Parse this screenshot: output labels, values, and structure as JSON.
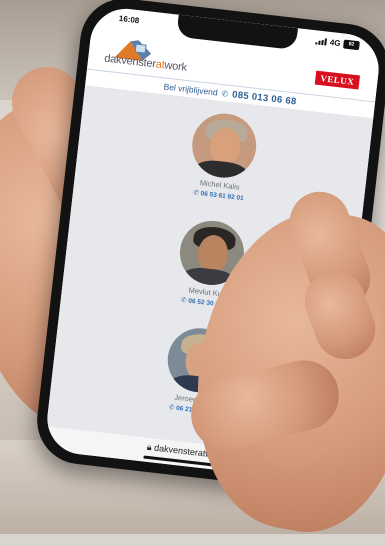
{
  "status": {
    "time": "16:08",
    "signal": "4G",
    "battery": "82"
  },
  "header": {
    "logo_main": "dakvenster",
    "logo_accent": "at",
    "logo_end": "work",
    "velux": "VELUX"
  },
  "callbar": {
    "label": "Bel vrijblijvend",
    "number": "085 013 06 68"
  },
  "people": [
    {
      "name": "Michel Kalis",
      "phone": "06 53 61 92 01"
    },
    {
      "name": "Mevlut Kurt",
      "phone": "06 52 30 86 12"
    },
    {
      "name": "Jeroen Duits",
      "phone": "06 21 25 37 06"
    }
  ],
  "address": {
    "url": "dakvensteratwork.n"
  },
  "colors": {
    "accent": "#2f6fb3",
    "brand_orange": "#e07a28",
    "velux_red": "#d8101e"
  }
}
